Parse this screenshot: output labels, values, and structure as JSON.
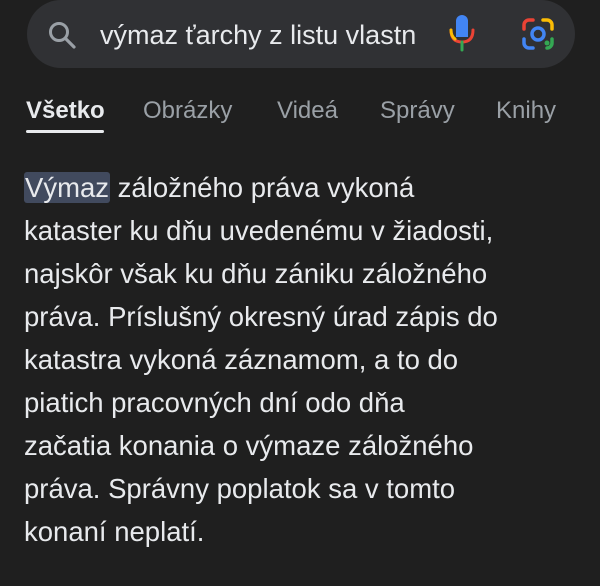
{
  "search": {
    "query": "výmaz ťarchy z listu vlastn"
  },
  "tabs": [
    {
      "label": "Všetko",
      "active": true
    },
    {
      "label": "Obrázky",
      "active": false
    },
    {
      "label": "Videá",
      "active": false
    },
    {
      "label": "Správy",
      "active": false
    },
    {
      "label": "Knihy",
      "active": false
    }
  ],
  "snippet": {
    "highlight": "Výmaz",
    "lines": [
      " záložného práva vykoná",
      "kataster ku dňu uvedenému v žiadosti,",
      "najskôr však ku dňu zániku záložného",
      "práva. Príslušný okresný úrad zápis do",
      "katastra vykoná záznamom, a to do",
      "piatich pracovných dní odo dňa",
      "začatia konania o výmaze záložného",
      "práva. Správny poplatok sa v tomto",
      "konaní neplatí."
    ]
  },
  "colors": {
    "background": "#1f1f1f",
    "search_bar": "#303134",
    "text": "#e8eaed",
    "muted": "#9aa0a6",
    "highlight": "#414a5e"
  },
  "icons": {
    "search": "search-icon",
    "mic": "mic-icon",
    "lens": "google-lens-icon"
  }
}
